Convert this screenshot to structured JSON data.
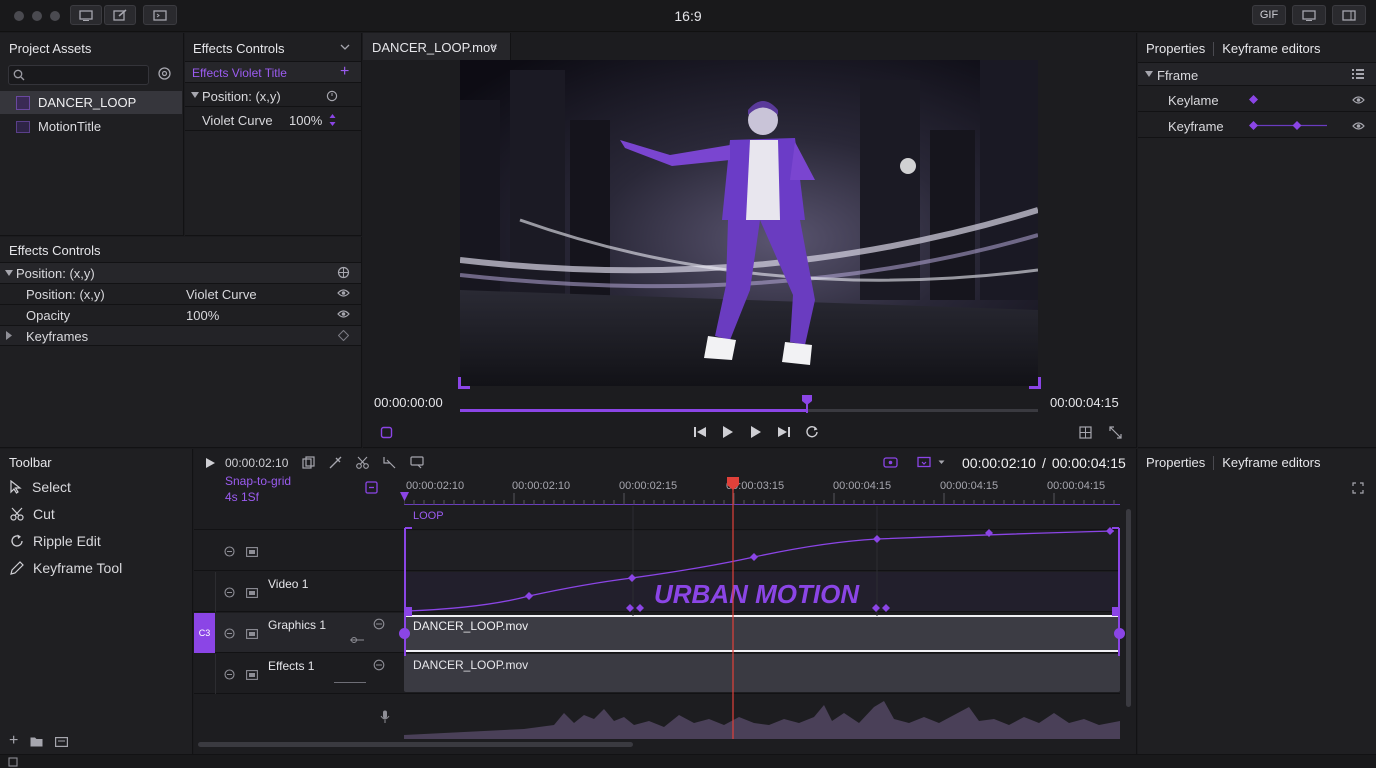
{
  "title_bar": {
    "title": "16:9",
    "gif_label": "GIF"
  },
  "project_assets": {
    "header": "Project Assets",
    "search_placeholder": "",
    "items": [
      {
        "label": "DANCER_LOOP",
        "selected": true
      },
      {
        "label": "MotionTitle",
        "selected": false
      }
    ]
  },
  "effects_controls_top": {
    "header": "Effects Controls",
    "title_row": "Effects Violet Title",
    "rows": [
      {
        "label": "Position: (x,y)"
      },
      {
        "label": "Violet Curve",
        "value": "100%"
      }
    ]
  },
  "effects_controls_bottom": {
    "header": "Effects Controls",
    "group": "Position: (x,y)",
    "rows": [
      {
        "label": "Position: (x,y)",
        "value": "Violet Curve"
      },
      {
        "label": "Opacity",
        "value": "100%"
      },
      {
        "label": "Keyframes",
        "value": ""
      }
    ]
  },
  "viewer": {
    "tab_label": "DANCER_LOOP.mov",
    "time_start": "00:00:00:00",
    "time_end": "00:00:04:15",
    "playhead_progress": 0.6
  },
  "properties_top": {
    "tab_properties": "Properties",
    "tab_keyframes": "Keyframe editors",
    "group": "Fframe",
    "rows": [
      {
        "label": "Keylame"
      },
      {
        "label": "Keyframe"
      }
    ]
  },
  "toolbar": {
    "header": "Toolbar",
    "tools": [
      {
        "label": "Select",
        "icon": "cursor-icon"
      },
      {
        "label": "Cut",
        "icon": "scissors-icon"
      },
      {
        "label": "Ripple Edit",
        "icon": "ripple-icon"
      },
      {
        "label": "Keyframe Tool",
        "icon": "pen-icon"
      }
    ]
  },
  "timeline": {
    "current_time": "00:00:02:10",
    "snap_label": "Snap-to-grid",
    "snap_value": "4s 1Sf",
    "time_display": "00:00:02:10",
    "time_total": "00:00:04:15",
    "time_sep": "/",
    "ruler": [
      "00:00:02:10",
      "00:00:02:10",
      "00:00:02:15",
      "00:00:03:15",
      "00:00:04:15",
      "00:00:04:15",
      "00:00:04:15"
    ],
    "loop_label": "LOOP",
    "title_overlay": "URBAN MOTION",
    "tracks": [
      {
        "name": "Video 1"
      },
      {
        "name": "Graphics 1",
        "badge": "C3"
      },
      {
        "name": "Effects 1"
      }
    ],
    "clips": [
      {
        "label": "DANCER_LOOP.mov"
      },
      {
        "label": "DANCER_LOOP.mov"
      }
    ],
    "playhead_progress": 0.46
  },
  "properties_bottom": {
    "tab_properties": "Properties",
    "tab_keyframes": "Keyframe editors"
  },
  "colors": {
    "accent": "#8b45e6",
    "playhead": "#e0413a",
    "bg": "#1b1b1e"
  }
}
